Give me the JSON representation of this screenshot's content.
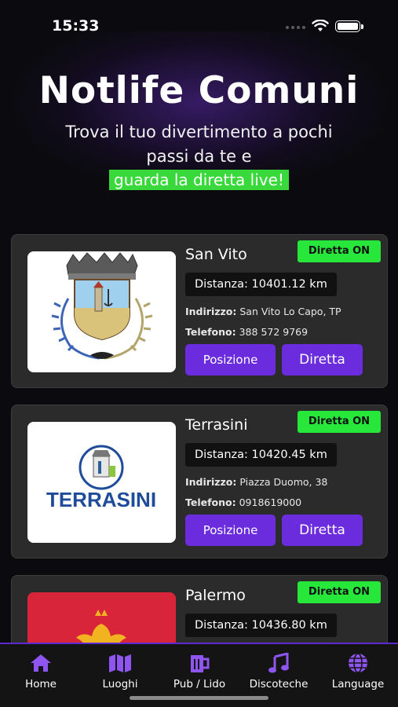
{
  "status_bar": {
    "time": "15:33"
  },
  "header": {
    "title": "Notlife Comuni",
    "subtitle_line1": "Trova il tuo divertimento a pochi",
    "subtitle_line2": "passi da te e",
    "highlight": "guarda la diretta live!"
  },
  "labels": {
    "address": "Indirizzo:",
    "phone": "Telefono:",
    "position_button": "Posizione",
    "live_button": "Diretta"
  },
  "places": [
    {
      "name": "San Vito",
      "badge": "Diretta ON",
      "distance": "Distanza: 10401.12 km",
      "address": "San Vito Lo Capo, TP",
      "phone": "388 572 9769"
    },
    {
      "name": "Terrasini",
      "badge": "Diretta ON",
      "distance": "Distanza: 10420.45 km",
      "address": "Piazza Duomo, 38",
      "phone": "0918619000",
      "logo_text": "TERRASINI"
    },
    {
      "name": "Palermo",
      "badge": "Diretta ON",
      "distance": "Distanza: 10436.80 km"
    }
  ],
  "tabbar": [
    {
      "label": "Home",
      "icon": "home-icon",
      "active": true
    },
    {
      "label": "Luoghi",
      "icon": "map-icon"
    },
    {
      "label": "Pub / Lido",
      "icon": "beer-icon"
    },
    {
      "label": "Discoteche",
      "icon": "music-note-icon"
    },
    {
      "label": "Language",
      "icon": "globe-icon"
    }
  ],
  "colors": {
    "accent": "#6a2cdc",
    "live_badge": "#27e73b",
    "tab_icon": "#8e55f0",
    "highlight_bg": "#39d83b"
  }
}
